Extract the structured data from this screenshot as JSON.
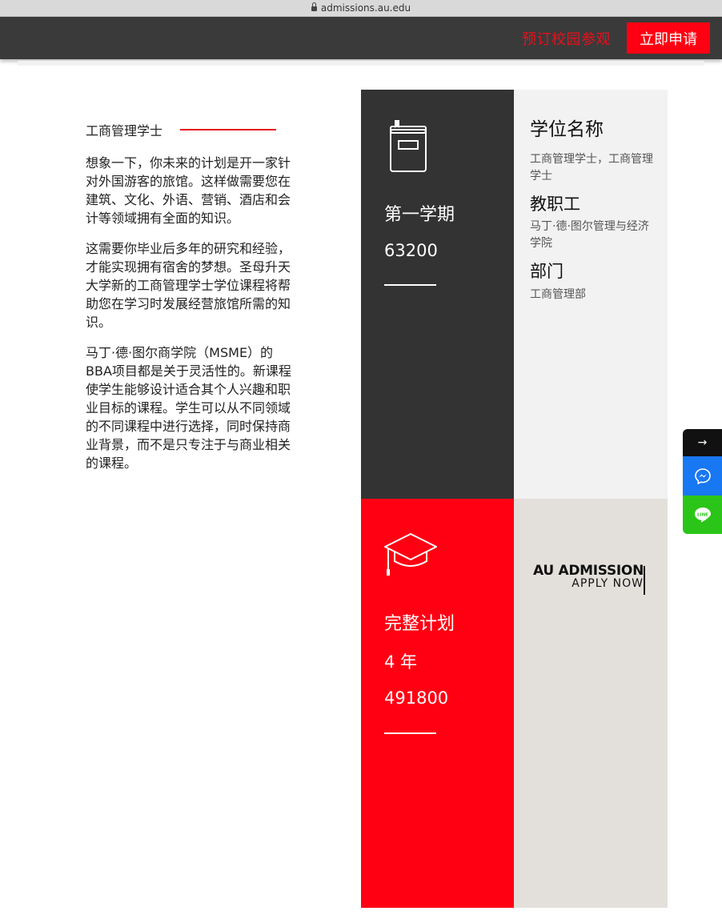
{
  "browser": {
    "url": "admissions.au.edu"
  },
  "header": {
    "tour_label": "预订校园参观",
    "apply_label": "立即申请"
  },
  "article": {
    "heading": "工商管理学士",
    "paragraphs": [
      "想象一下，你未来的计划是开一家针对外国游客的旅馆。这样做需要您在建筑、文化、外语、营销、酒店和会计等领域拥有全面的知识。",
      "这需要你毕业后多年的研究和经验，才能实现拥有宿舍的梦想。圣母升天大学新的工商管理学士学位课程将帮助您在学习时发展经营旅馆所需的知识。",
      "马丁·德·图尔商学院（MSME）的BBA项目都是关于灵活性的。新课程使学生能够设计适合其个人兴趣和职业目标的课程。学生可以从不同领域的不同课程中进行选择，同时保持商业背景，而不是只专注于与商业相关的课程。"
    ]
  },
  "semester": {
    "label": "第一学期",
    "fee": "63200"
  },
  "degree_info": {
    "degree_name_label": "学位名称",
    "degree_name_value": "工商管理学士，工商管理学士",
    "faculty_label": "教职工",
    "faculty_value": "马丁·德·图尔管理与经济学院",
    "department_label": "部门",
    "department_value": "工商管理部"
  },
  "full_program": {
    "label": "完整计划",
    "duration": "4 年",
    "fee": "491800"
  },
  "logo": {
    "main": "AU ADMISSION",
    "sub": "APPLY NOW"
  },
  "side_buttons": {
    "arrow": "→",
    "icons": [
      "messenger-icon",
      "line-icon"
    ]
  },
  "colors": {
    "accent_red": "#ff0013",
    "dark": "#333333",
    "light": "#f2f2f2",
    "beige": "#e3e0dc"
  }
}
